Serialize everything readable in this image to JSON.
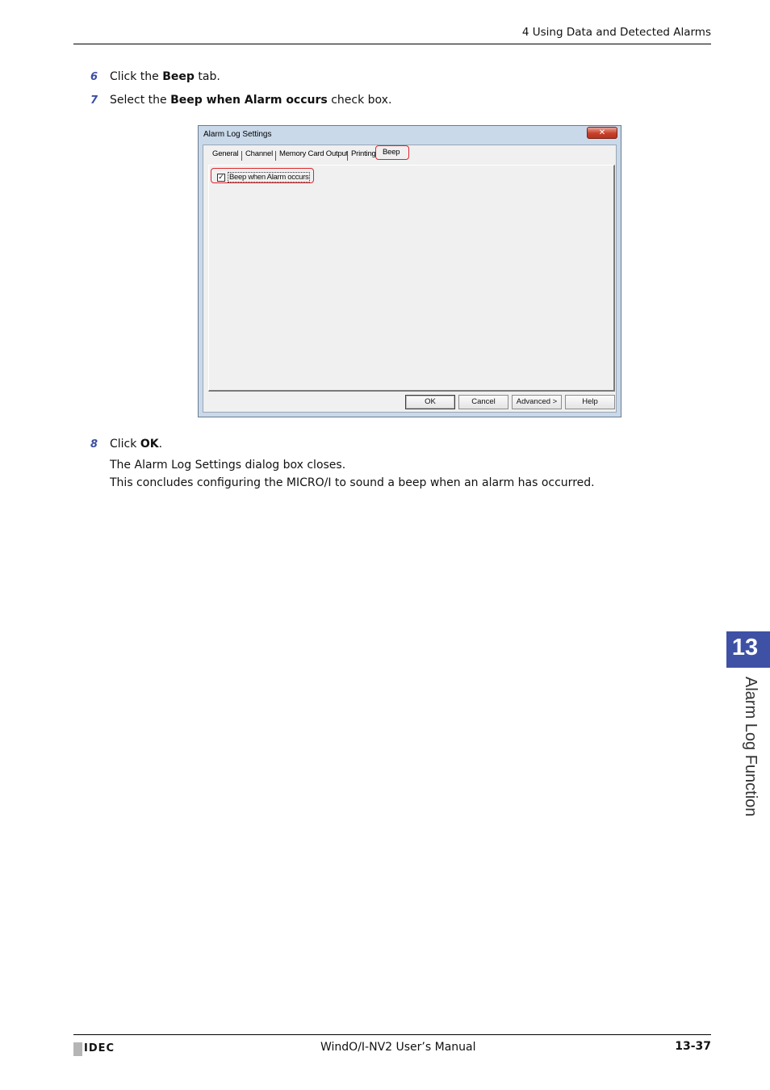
{
  "header": {
    "section_title": "4 Using Data and Detected Alarms"
  },
  "steps": [
    {
      "num": "6",
      "pre": "Click the ",
      "bold": "Beep",
      "post": " tab."
    },
    {
      "num": "7",
      "pre": "Select the ",
      "bold": "Beep when Alarm occurs",
      "post": " check box."
    },
    {
      "num": "8",
      "pre": "Click ",
      "bold": "OK",
      "post": "."
    }
  ],
  "paragraphs": [
    "The Alarm Log Settings dialog box closes.",
    "This concludes configuring the MICRO/I to sound a beep when an alarm has occurred."
  ],
  "dialog": {
    "title": "Alarm Log Settings",
    "close_glyph": "✕",
    "tabs": [
      "General",
      "Channel",
      "Memory Card Output",
      "Printing",
      "Beep"
    ],
    "checkbox": {
      "label": "Beep when Alarm occurs",
      "checked": true,
      "mark": "✓"
    },
    "buttons": {
      "ok": "OK",
      "cancel": "Cancel",
      "advanced": "Advanced >",
      "help": "Help"
    },
    "highlight_color": "#e0242b"
  },
  "side_tab": {
    "chapter_number": "13",
    "chapter_title": "Alarm Log Function",
    "color": "#3f51a4"
  },
  "footer": {
    "brand": "IDEC",
    "manual_title": "WindO/I-NV2 User’s Manual",
    "page_number": "13-37"
  }
}
